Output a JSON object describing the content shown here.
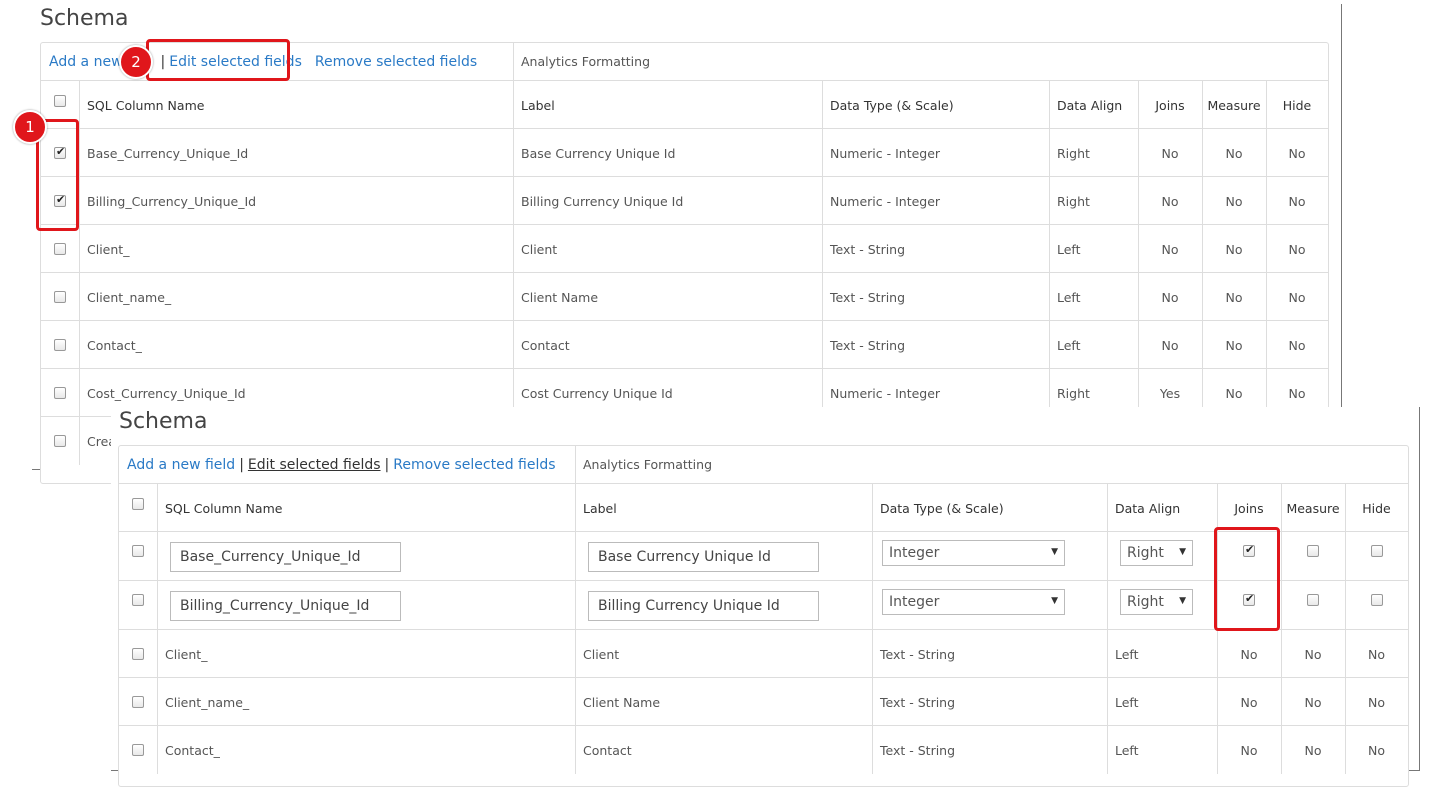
{
  "top": {
    "title": "Schema",
    "toolbar": {
      "add": "Add a new",
      "sep1": "|",
      "edit": "Edit selected fields",
      "remove": "Remove selected fields",
      "analytics": "Analytics Formatting"
    },
    "headers": {
      "sql": "SQL Column Name",
      "label": "Label",
      "dtype": "Data Type (& Scale)",
      "align": "Data Align",
      "joins": "Joins",
      "measure": "Measure",
      "hide": "Hide"
    },
    "rows": [
      {
        "sql": "Base_Currency_Unique_Id",
        "label": "Base Currency Unique Id",
        "dtype": "Numeric - Integer",
        "align": "Right",
        "joins": "No",
        "measure": "No",
        "hide": "No",
        "checked": true
      },
      {
        "sql": "Billing_Currency_Unique_Id",
        "label": "Billing Currency Unique Id",
        "dtype": "Numeric - Integer",
        "align": "Right",
        "joins": "No",
        "measure": "No",
        "hide": "No",
        "checked": true
      },
      {
        "sql": "Client_",
        "label": "Client",
        "dtype": "Text - String",
        "align": "Left",
        "joins": "No",
        "measure": "No",
        "hide": "No",
        "checked": false
      },
      {
        "sql": "Client_name_",
        "label": "Client Name",
        "dtype": "Text - String",
        "align": "Left",
        "joins": "No",
        "measure": "No",
        "hide": "No",
        "checked": false
      },
      {
        "sql": "Contact_",
        "label": "Contact",
        "dtype": "Text - String",
        "align": "Left",
        "joins": "No",
        "measure": "No",
        "hide": "No",
        "checked": false
      },
      {
        "sql": "Cost_Currency_Unique_Id",
        "label": "Cost Currency Unique Id",
        "dtype": "Numeric - Integer",
        "align": "Right",
        "joins": "Yes",
        "measure": "No",
        "hide": "No",
        "checked": false
      },
      {
        "sql": "Crea",
        "checked": false
      }
    ]
  },
  "bottom": {
    "title": "Schema",
    "toolbar": {
      "add": "Add a new field",
      "sep1": "|",
      "edit": "Edit selected fields",
      "sep2": "|",
      "remove": "Remove selected fields",
      "analytics": "Analytics Formatting"
    },
    "headers": {
      "sql": "SQL Column Name",
      "label": "Label",
      "dtype": "Data Type (& Scale)",
      "align": "Data Align",
      "joins": "Joins",
      "measure": "Measure",
      "hide": "Hide"
    },
    "edit_rows": [
      {
        "sql": "Base_Currency_Unique_Id",
        "label": "Base Currency Unique Id",
        "dtype": "Integer",
        "align": "Right",
        "joins": true,
        "measure": false,
        "hide": false
      },
      {
        "sql": "Billing_Currency_Unique_Id",
        "label": "Billing Currency Unique Id",
        "dtype": "Integer",
        "align": "Right",
        "joins": true,
        "measure": false,
        "hide": false
      }
    ],
    "rows": [
      {
        "sql": "Client_",
        "label": "Client",
        "dtype": "Text - String",
        "align": "Left",
        "joins": "No",
        "measure": "No",
        "hide": "No"
      },
      {
        "sql": "Client_name_",
        "label": "Client Name",
        "dtype": "Text - String",
        "align": "Left",
        "joins": "No",
        "measure": "No",
        "hide": "No"
      },
      {
        "sql": "Contact_",
        "label": "Contact",
        "dtype": "Text - String",
        "align": "Left",
        "joins": "No",
        "measure": "No",
        "hide": "No"
      }
    ]
  },
  "annotations": {
    "badge1": "1",
    "badge2": "2"
  },
  "colors": {
    "accent": "#e0161b",
    "link": "#2a7ac6"
  }
}
